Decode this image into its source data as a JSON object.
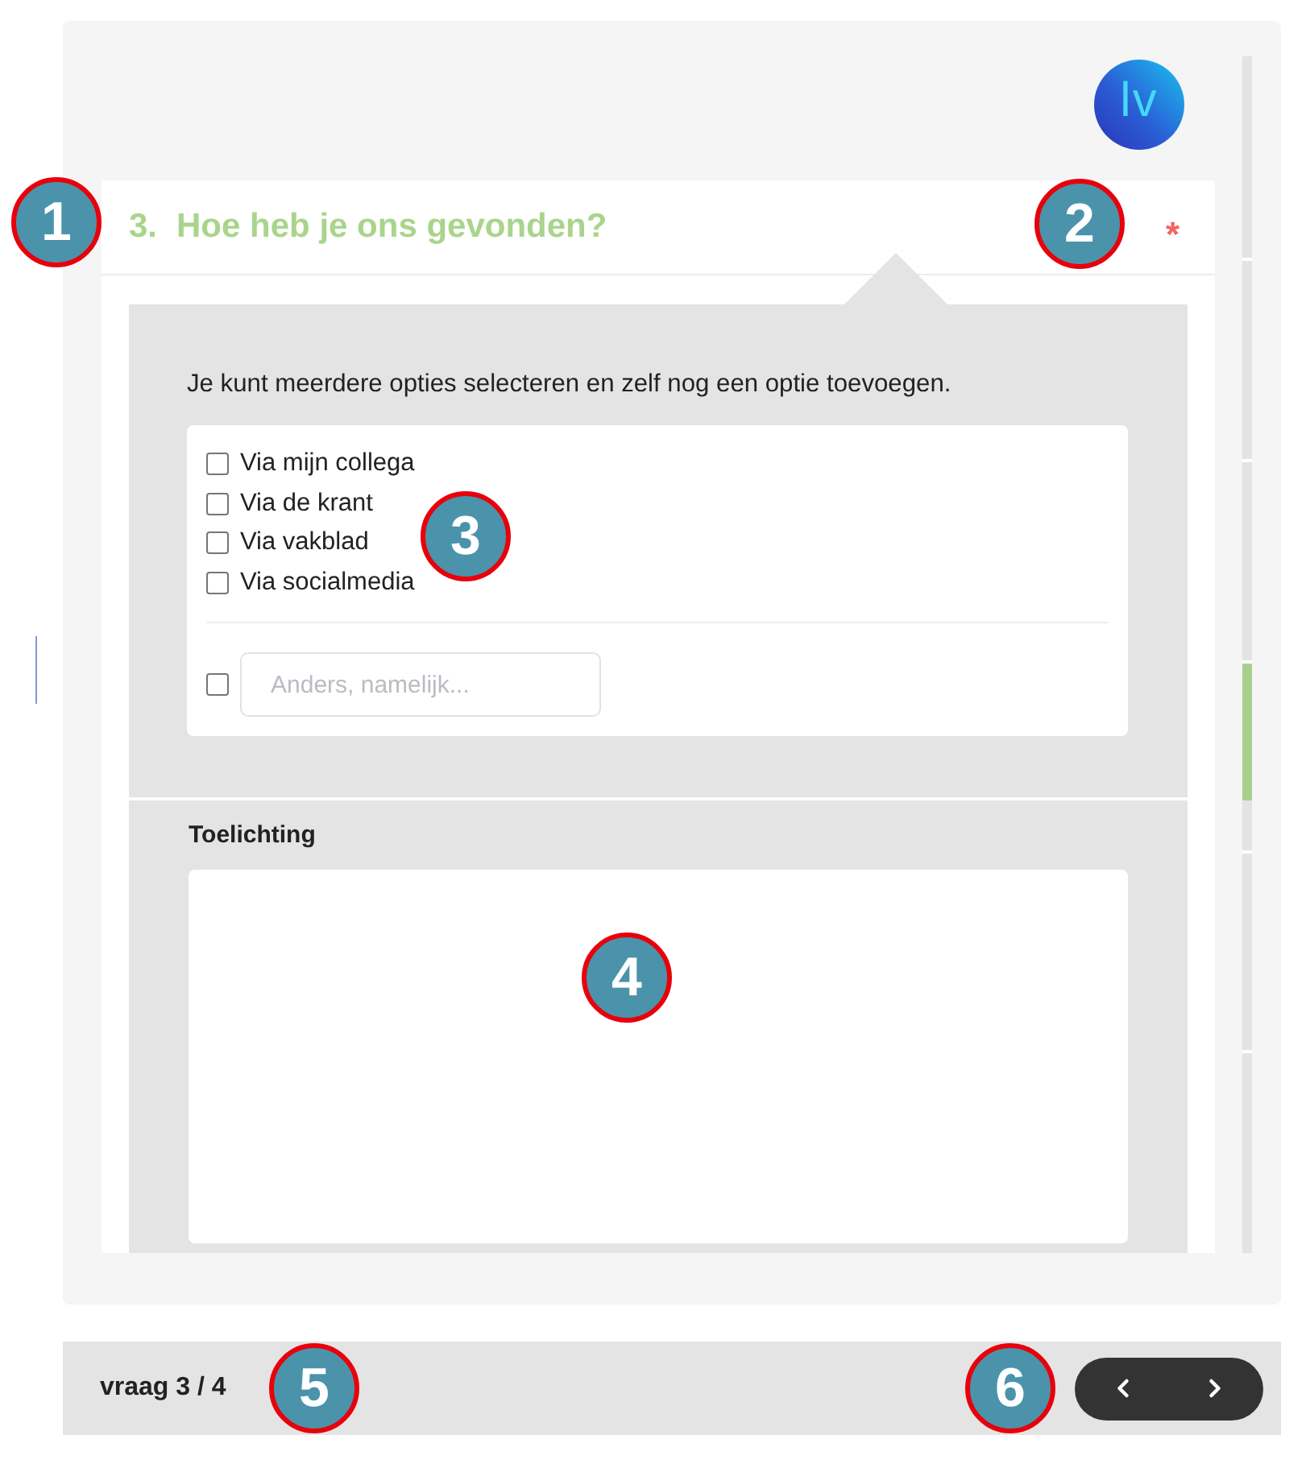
{
  "logo": {
    "text": "lv"
  },
  "question": {
    "number": "3.",
    "title": "Hoe heb je ons gevonden?",
    "required_mark": "*"
  },
  "instruction": "Je kunt meerdere opties selecteren en zelf nog een optie toevoegen.",
  "options": [
    {
      "label": "Via mijn collega",
      "checked": false
    },
    {
      "label": "Via de krant",
      "checked": false
    },
    {
      "label": "Via vakblad",
      "checked": false
    },
    {
      "label": "Via socialmedia",
      "checked": false
    }
  ],
  "other_option": {
    "checked": false,
    "placeholder": "Anders, namelijk..."
  },
  "explanation": {
    "label": "Toelichting"
  },
  "footer": {
    "counter": "vraag 3 / 4"
  },
  "callouts": [
    {
      "label": "1"
    },
    {
      "label": "2"
    },
    {
      "label": "3"
    },
    {
      "label": "4"
    },
    {
      "label": "5"
    },
    {
      "label": "6"
    }
  ]
}
